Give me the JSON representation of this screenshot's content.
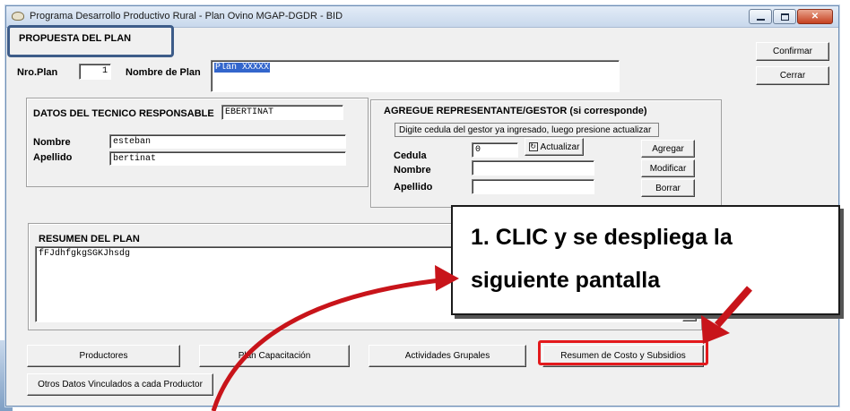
{
  "window": {
    "title": "Programa Desarrollo Productivo Rural - Plan Ovino  MGAP-DGDR - BID",
    "header_label": "PROPUESTA DEL PLAN"
  },
  "actions": {
    "confirm": "Confirmar",
    "close": "Cerrar"
  },
  "plan": {
    "nro_label": "Nro.Plan",
    "nro_value": "1",
    "nombre_label": "Nombre de Plan",
    "nombre_value": "Plan XXXXX"
  },
  "tecnico": {
    "title": "DATOS DEL TECNICO RESPONSABLE",
    "user": "EBERTINAT",
    "nombre_label": "Nombre",
    "nombre_value": "esteban",
    "apellido_label": "Apellido",
    "apellido_value": "bertinat"
  },
  "representante": {
    "title": "AGREGUE REPRESENTANTE/GESTOR (si corresponde)",
    "hint": "Digite cedula del gestor ya ingresado, luego presione actualizar",
    "cedula_label": "Cedula",
    "cedula_value": "0",
    "actualizar_label": "Actualizar",
    "nombre_label": "Nombre",
    "nombre_value": "",
    "apellido_label": "Apellido",
    "apellido_value": "",
    "agregar": "Agregar",
    "modificar": "Modificar",
    "borrar": "Borrar"
  },
  "resumen": {
    "title": "RESUMEN DEL PLAN",
    "text": "fFJdhfgkgSGKJhsdg"
  },
  "bottom_buttons": {
    "productores": "Productores",
    "capacitacion": "Plan Capacitación",
    "actividades": "Actividades Grupales",
    "costo": "Resumen de Costo y Subsidios",
    "otros": "Otros Datos Vinculados a cada Productor"
  },
  "annotation": {
    "line1": "1. CLIC y se despliega la",
    "line2": "siguiente pantalla"
  },
  "colors": {
    "highlight": "#e3191c",
    "header_box": "#3d5c89",
    "selection": "#3366cc"
  }
}
